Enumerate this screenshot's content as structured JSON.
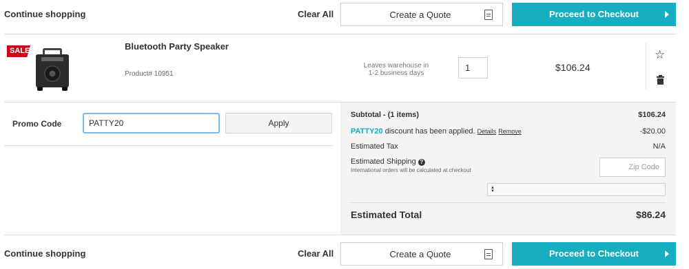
{
  "top_bar": {
    "continue_label": "Continue shopping",
    "clear_all_label": "Clear All",
    "quote_label": "Create a Quote",
    "checkout_label": "Proceed to Checkout"
  },
  "item": {
    "badge": "SALE",
    "name": "Bluetooth Party Speaker",
    "product_number": "Product# 10951",
    "leaves_line1": "Leaves warehouse in",
    "leaves_line2": "1-2 business days",
    "quantity": "1",
    "price": "$106.24",
    "favorite_icon": "star-outline-icon",
    "delete_icon": "trash-icon"
  },
  "promo": {
    "label": "Promo Code",
    "value": "PATTY20",
    "apply_label": "Apply"
  },
  "summary": {
    "subtotal_label": "Subtotal - (1 items)",
    "subtotal_value": "$106.24",
    "discount_code": "PATTY20",
    "discount_text": " discount has been applied. ",
    "details_link": "Details",
    "remove_link": "Remove",
    "discount_value": "-$20.00",
    "tax_label": "Estimated Tax",
    "tax_value": "N/A",
    "shipping_label": "Estimated Shipping",
    "shipping_note": "International orders will be calculated at checkout",
    "zip_placeholder": "Zip Code",
    "total_label": "Estimated Total",
    "total_value": "$86.24"
  },
  "bottom_bar": {
    "continue_label": "Continue shopping",
    "clear_all_label": "Clear All",
    "quote_label": "Create a Quote",
    "checkout_label": "Proceed to Checkout"
  },
  "colors": {
    "accent": "#16aec0",
    "sale_badge": "#d0021b",
    "summary_bg": "#f4f4f4"
  }
}
